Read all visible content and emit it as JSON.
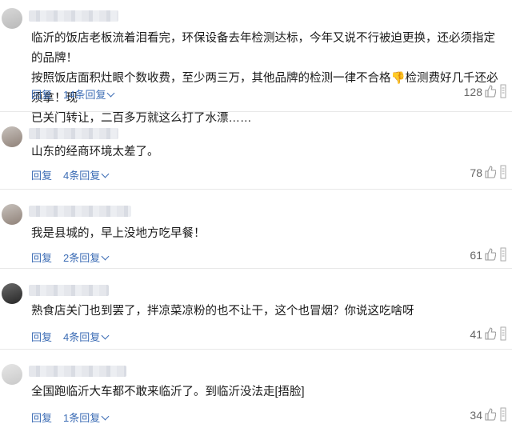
{
  "comments": [
    {
      "text": "临沂的饭店老板流着泪看完，环保设备去年检测达标，今年又说不行被迫更换，还必须指定的品牌！\n按照饭店面积灶眼个数收费，至少两三万，其他品牌的检测一律不合格👎检测费好几千还必须拿！现\n已关门转让，二百多万就这么打了水漂……",
      "reply_label": "回复",
      "replies_label": "14条回复",
      "likes": "128"
    },
    {
      "text": "山东的经商环境太差了。",
      "reply_label": "回复",
      "replies_label": "4条回复",
      "likes": "78"
    },
    {
      "text": "我是县城的，早上没地方吃早餐！",
      "reply_label": "回复",
      "replies_label": "2条回复",
      "likes": "61"
    },
    {
      "text": "熟食店关门也到罢了，拌凉菜凉粉的也不让干，这个也冒烟？你说这吃啥呀",
      "reply_label": "回复",
      "replies_label": "4条回复",
      "likes": "41"
    },
    {
      "text": "全国跑临沂大车都不敢来临沂了。到临沂没法走[捂脸]",
      "reply_label": "回复",
      "replies_label": "1条回复",
      "likes": "34"
    }
  ]
}
